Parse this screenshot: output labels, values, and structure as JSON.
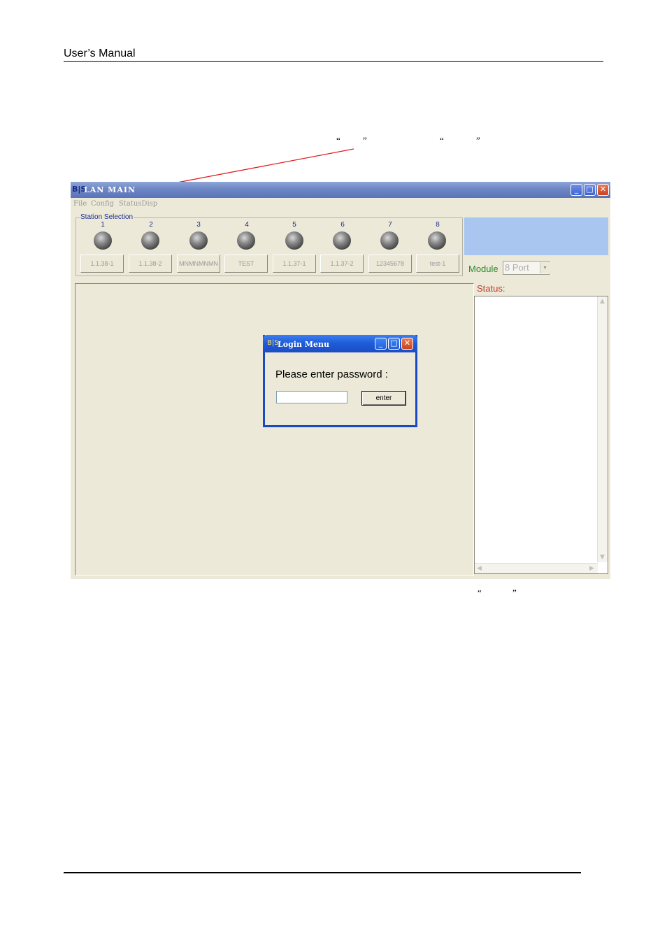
{
  "document": {
    "header": "User’s  Manual",
    "quotes_top": [
      "“",
      "”",
      "“",
      "”"
    ],
    "quotes_bottom": [
      "“",
      "”"
    ]
  },
  "app": {
    "title": "LAN MAIN",
    "icon_text": "B|S",
    "controls": {
      "minimize": "_",
      "maximize": "□",
      "close": "✕"
    },
    "menu": [
      "File",
      "Config",
      "StatusDisp"
    ],
    "station_selection": {
      "legend": "Station Selection",
      "stations": [
        {
          "number": "1",
          "label": "1.1.38-1"
        },
        {
          "number": "2",
          "label": "1.1.38-2"
        },
        {
          "number": "3",
          "label": "MNMNMNMN"
        },
        {
          "number": "4",
          "label": "TEST"
        },
        {
          "number": "5",
          "label": "1.1.37-1"
        },
        {
          "number": "6",
          "label": "1.1.37-2"
        },
        {
          "number": "7",
          "label": "12345678"
        },
        {
          "number": "8",
          "label": "test-1"
        }
      ]
    },
    "module": {
      "label": "Module",
      "value": "8 Port",
      "arrow": "▾"
    },
    "status": {
      "label": "Status:",
      "up": "▲",
      "down": "▼",
      "left": "◀",
      "right": "▶"
    }
  },
  "login": {
    "title": "Login Menu",
    "icon_text": "B|S",
    "controls": {
      "minimize": "_",
      "maximize": "□",
      "close": "✕"
    },
    "prompt": "Please enter password :",
    "password_value": "",
    "enter_label": "enter"
  },
  "colors": {
    "window_bg": "#ece9d8",
    "title_inactive": "#6d86c5",
    "title_active": "#1e5ad8",
    "station_text": "#1d2f8f",
    "module_label": "#2b8a2b",
    "status_label": "#c0392b",
    "annotation_arrow": "#e02020"
  }
}
